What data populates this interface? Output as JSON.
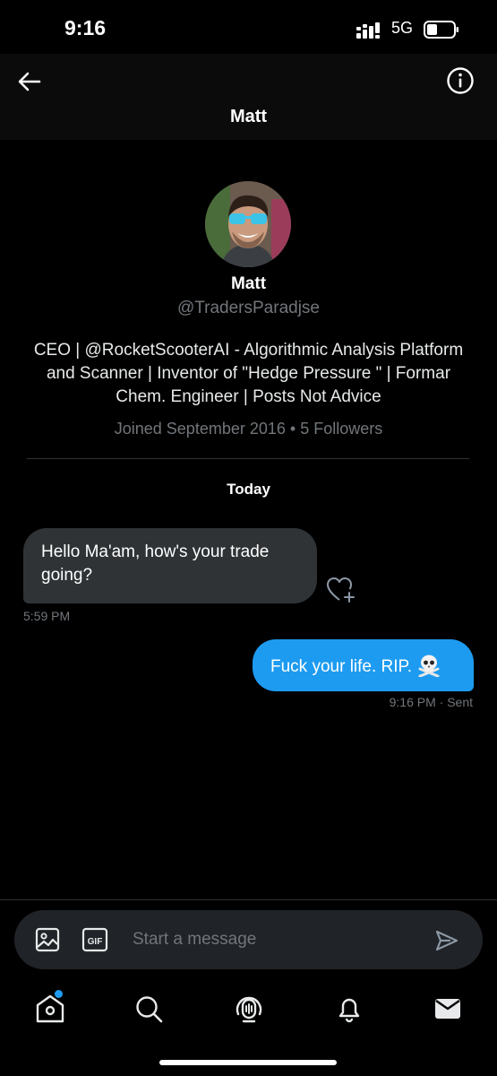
{
  "status_bar": {
    "time": "9:16",
    "network": "5G"
  },
  "header": {
    "title": "Matt"
  },
  "profile": {
    "name": "Matt",
    "handle": "@TradersParadjse",
    "bio": "CEO | @RocketScooterAI - Algorithmic Analysis Platform and Scanner | Inventor of \"Hedge Pressure \" | Formar Chem. Engineer | Posts Not Advice",
    "meta": "Joined September 2016 • 5 Followers"
  },
  "conversation": {
    "date_label": "Today",
    "messages": [
      {
        "direction": "incoming",
        "text": "Hello Ma'am, how's your trade going?",
        "time": "5:59 PM"
      },
      {
        "direction": "outgoing",
        "text": "Fuck your life. RIP.",
        "emoji": "skull-and-crossbones",
        "time": "9:16 PM · Sent"
      }
    ]
  },
  "composer": {
    "placeholder": "Start a message",
    "gif_label": "GIF"
  },
  "nav": {
    "items": [
      "home-icon",
      "search-icon",
      "spaces-icon",
      "notifications-icon",
      "messages-icon"
    ]
  },
  "colors": {
    "accent": "#1d9bf0",
    "incoming_bubble": "#2f3336",
    "muted_text": "#71767b"
  }
}
